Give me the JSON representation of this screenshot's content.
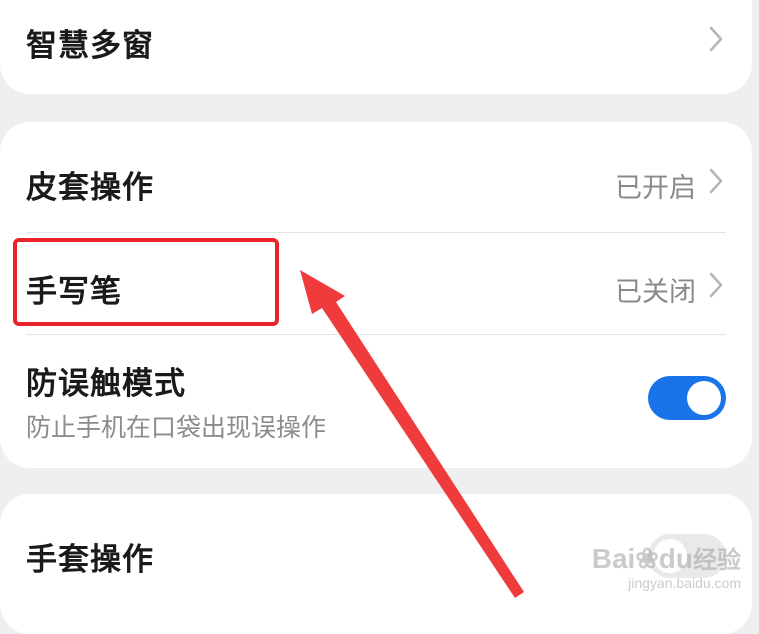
{
  "colors": {
    "accent": "#1a73e8",
    "switch_off": "#e9e9eb",
    "highlight": "#e8232b",
    "arrow": "#ef3b3b"
  },
  "items": [
    {
      "title": "智慧多窗",
      "value": ""
    },
    {
      "title": "皮套操作",
      "value": "已开启"
    },
    {
      "title": "手写笔",
      "value": "已关闭"
    },
    {
      "title": "防误触模式",
      "subtitle": "防止手机在口袋出现误操作",
      "switch_on": true
    },
    {
      "title": "手套操作",
      "switch_on": false
    }
  ],
  "watermark": {
    "main": "Bai",
    "main_suffix": "du",
    "cn": "经验",
    "sub": "jingyan.baidu.com"
  }
}
